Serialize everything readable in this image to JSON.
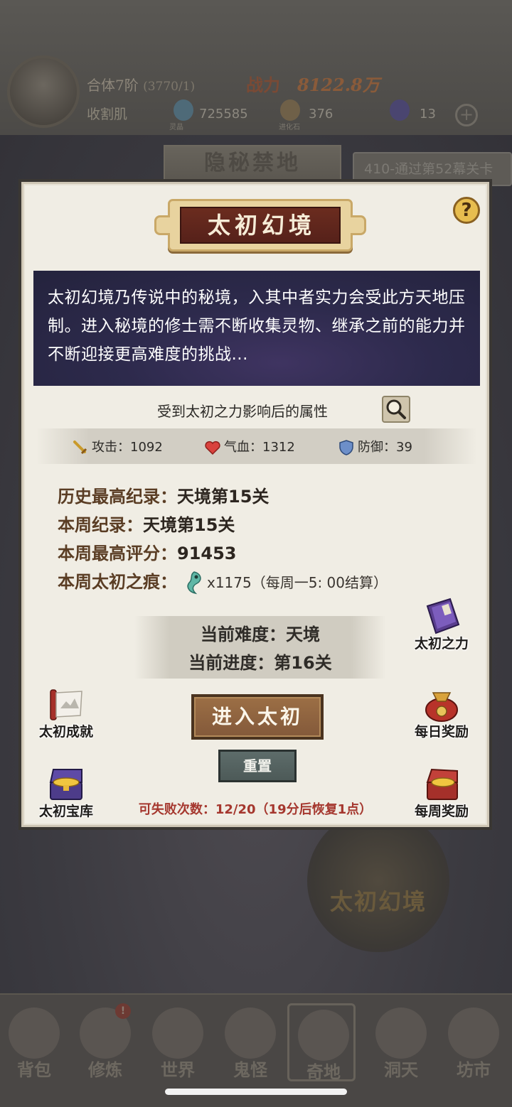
{
  "background": {
    "player": {
      "realm": "合体7阶",
      "realm_sub": "(3770/1)",
      "name": "收割肌",
      "power_label": "战力",
      "power_value": "8122.8万"
    },
    "resources": [
      {
        "icon": "spirit-crystal-icon",
        "value": "725585",
        "label": "灵晶"
      },
      {
        "icon": "stone-icon",
        "value": "376",
        "label": "进化石"
      },
      {
        "icon": "purple-flame-icon",
        "value": "13"
      }
    ],
    "plus": "+",
    "section_title": "隐秘禁地",
    "quest": "410-通过第52幕关卡",
    "emblem_label": "太初幻境",
    "nav": [
      {
        "label": "背包",
        "icon": "bag-icon"
      },
      {
        "label": "修炼",
        "icon": "lotus-icon",
        "badge": "!"
      },
      {
        "label": "世界",
        "icon": "world-icon"
      },
      {
        "label": "鬼怪",
        "icon": "ghost-icon"
      },
      {
        "label": "奇地",
        "icon": "palace-icon"
      },
      {
        "label": "洞天",
        "icon": "portal-icon"
      },
      {
        "label": "坊市",
        "icon": "market-icon"
      }
    ]
  },
  "modal": {
    "title": "太初幻境",
    "help": "?",
    "description": "太初幻境乃传说中的秘境，入其中者实力会受此方天地压制。进入秘境的修士需不断收集灵物、继承之前的能力并不断迎接更高难度的挑战...",
    "affected_label": "受到太初之力影响后的属性",
    "stats": {
      "attack": "攻击：1092",
      "hp": "气血：1312",
      "defense": "防御：39"
    },
    "records": {
      "history_label": "历史最高纪录：",
      "history_value": "天境第15关",
      "week_label": "本周纪录：",
      "week_value": "天境第15关",
      "score_label": "本周最高评分：",
      "score_value": "91453",
      "trace_label": "本周太初之痕：",
      "trace_count": "x1175（每周一5: 00结算）"
    },
    "difficulty": "当前难度：天境",
    "progress": "当前进度：第16关",
    "side": {
      "power": "太初之力",
      "achievement": "太初成就",
      "daily": "每日奖励",
      "vault": "太初宝库",
      "weekly": "每周奖励"
    },
    "enter_label": "进入太初",
    "reset_label": "重置",
    "fail_count": "可失败次数：12/20（19分后恢复1点）"
  }
}
